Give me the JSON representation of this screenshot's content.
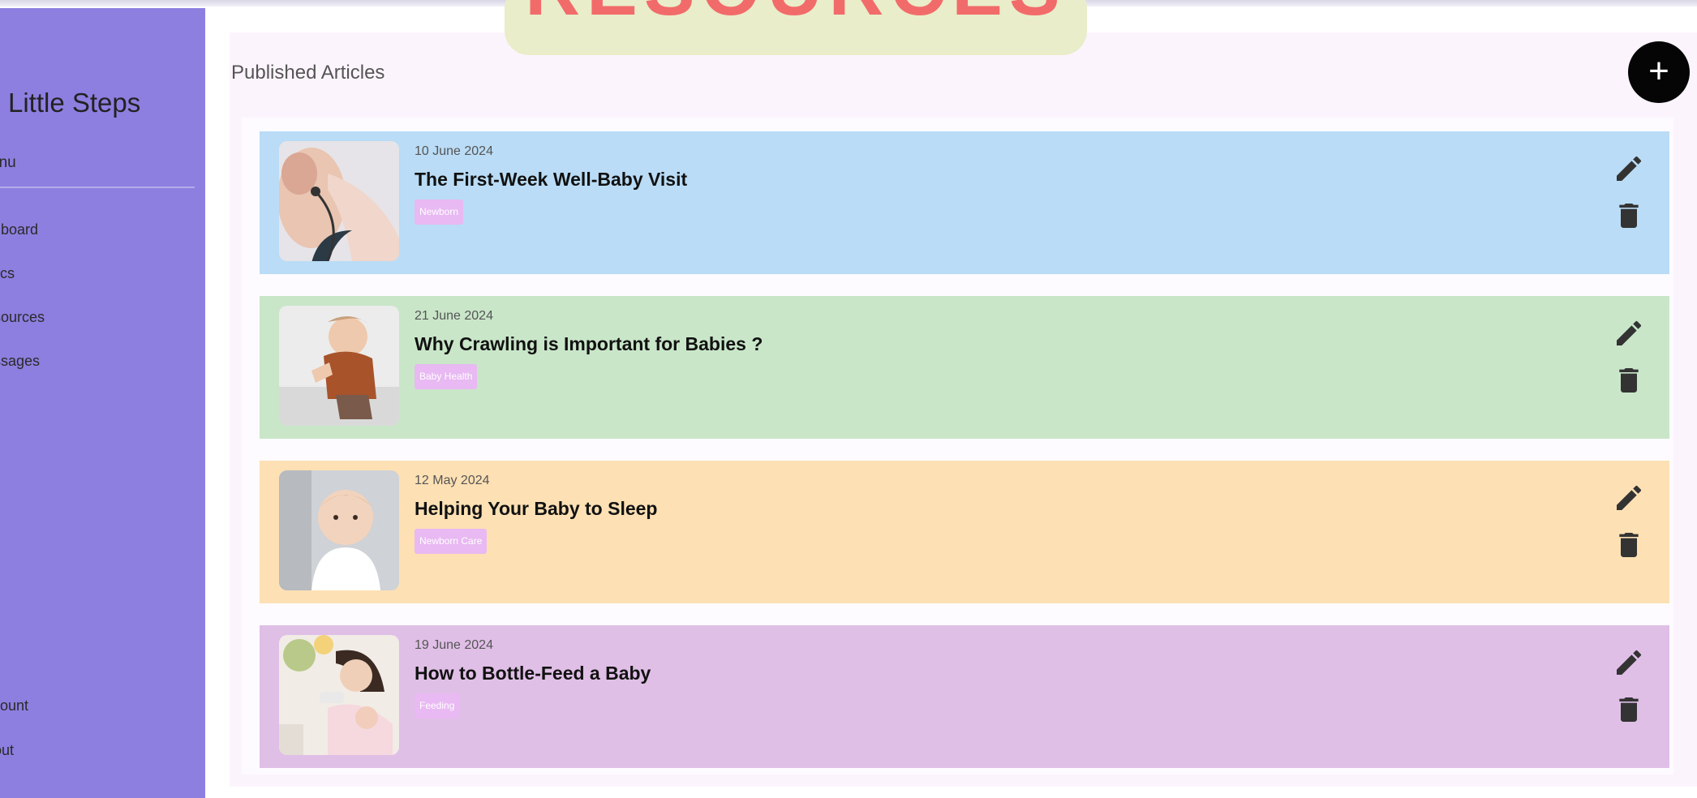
{
  "sidebar": {
    "brand": "Little Steps",
    "menu_label": "enu",
    "nav_items": [
      "shboard",
      "inics",
      "esources",
      "essages"
    ],
    "bottom_items": [
      "ccount",
      "gout"
    ],
    "bg_color": "#8d7fe0"
  },
  "banner": {
    "text": "RESOURCES",
    "bg_color": "#e9edc9",
    "text_color": "#f26b6b"
  },
  "main": {
    "title": "Published Articles",
    "add_button_icon": "plus-icon",
    "articles": [
      {
        "date": "10 June 2024",
        "title": "The First-Week Well-Baby Visit",
        "tag": "Newborn",
        "color": "#badcf6"
      },
      {
        "date": "21 June 2024",
        "title": "Why Crawling is Important for Babies ?",
        "tag": "Baby Health",
        "color": "#c9e6c9"
      },
      {
        "date": "12 May 2024",
        "title": "Helping Your Baby to Sleep",
        "tag": "Newborn Care",
        "color": "#fde0b4"
      },
      {
        "date": "19 June 2024",
        "title": "How to Bottle-Feed a Baby",
        "tag": "Feeding",
        "color": "#e0bfe7"
      }
    ],
    "row_icons": [
      "pencil-icon",
      "trash-icon"
    ]
  }
}
